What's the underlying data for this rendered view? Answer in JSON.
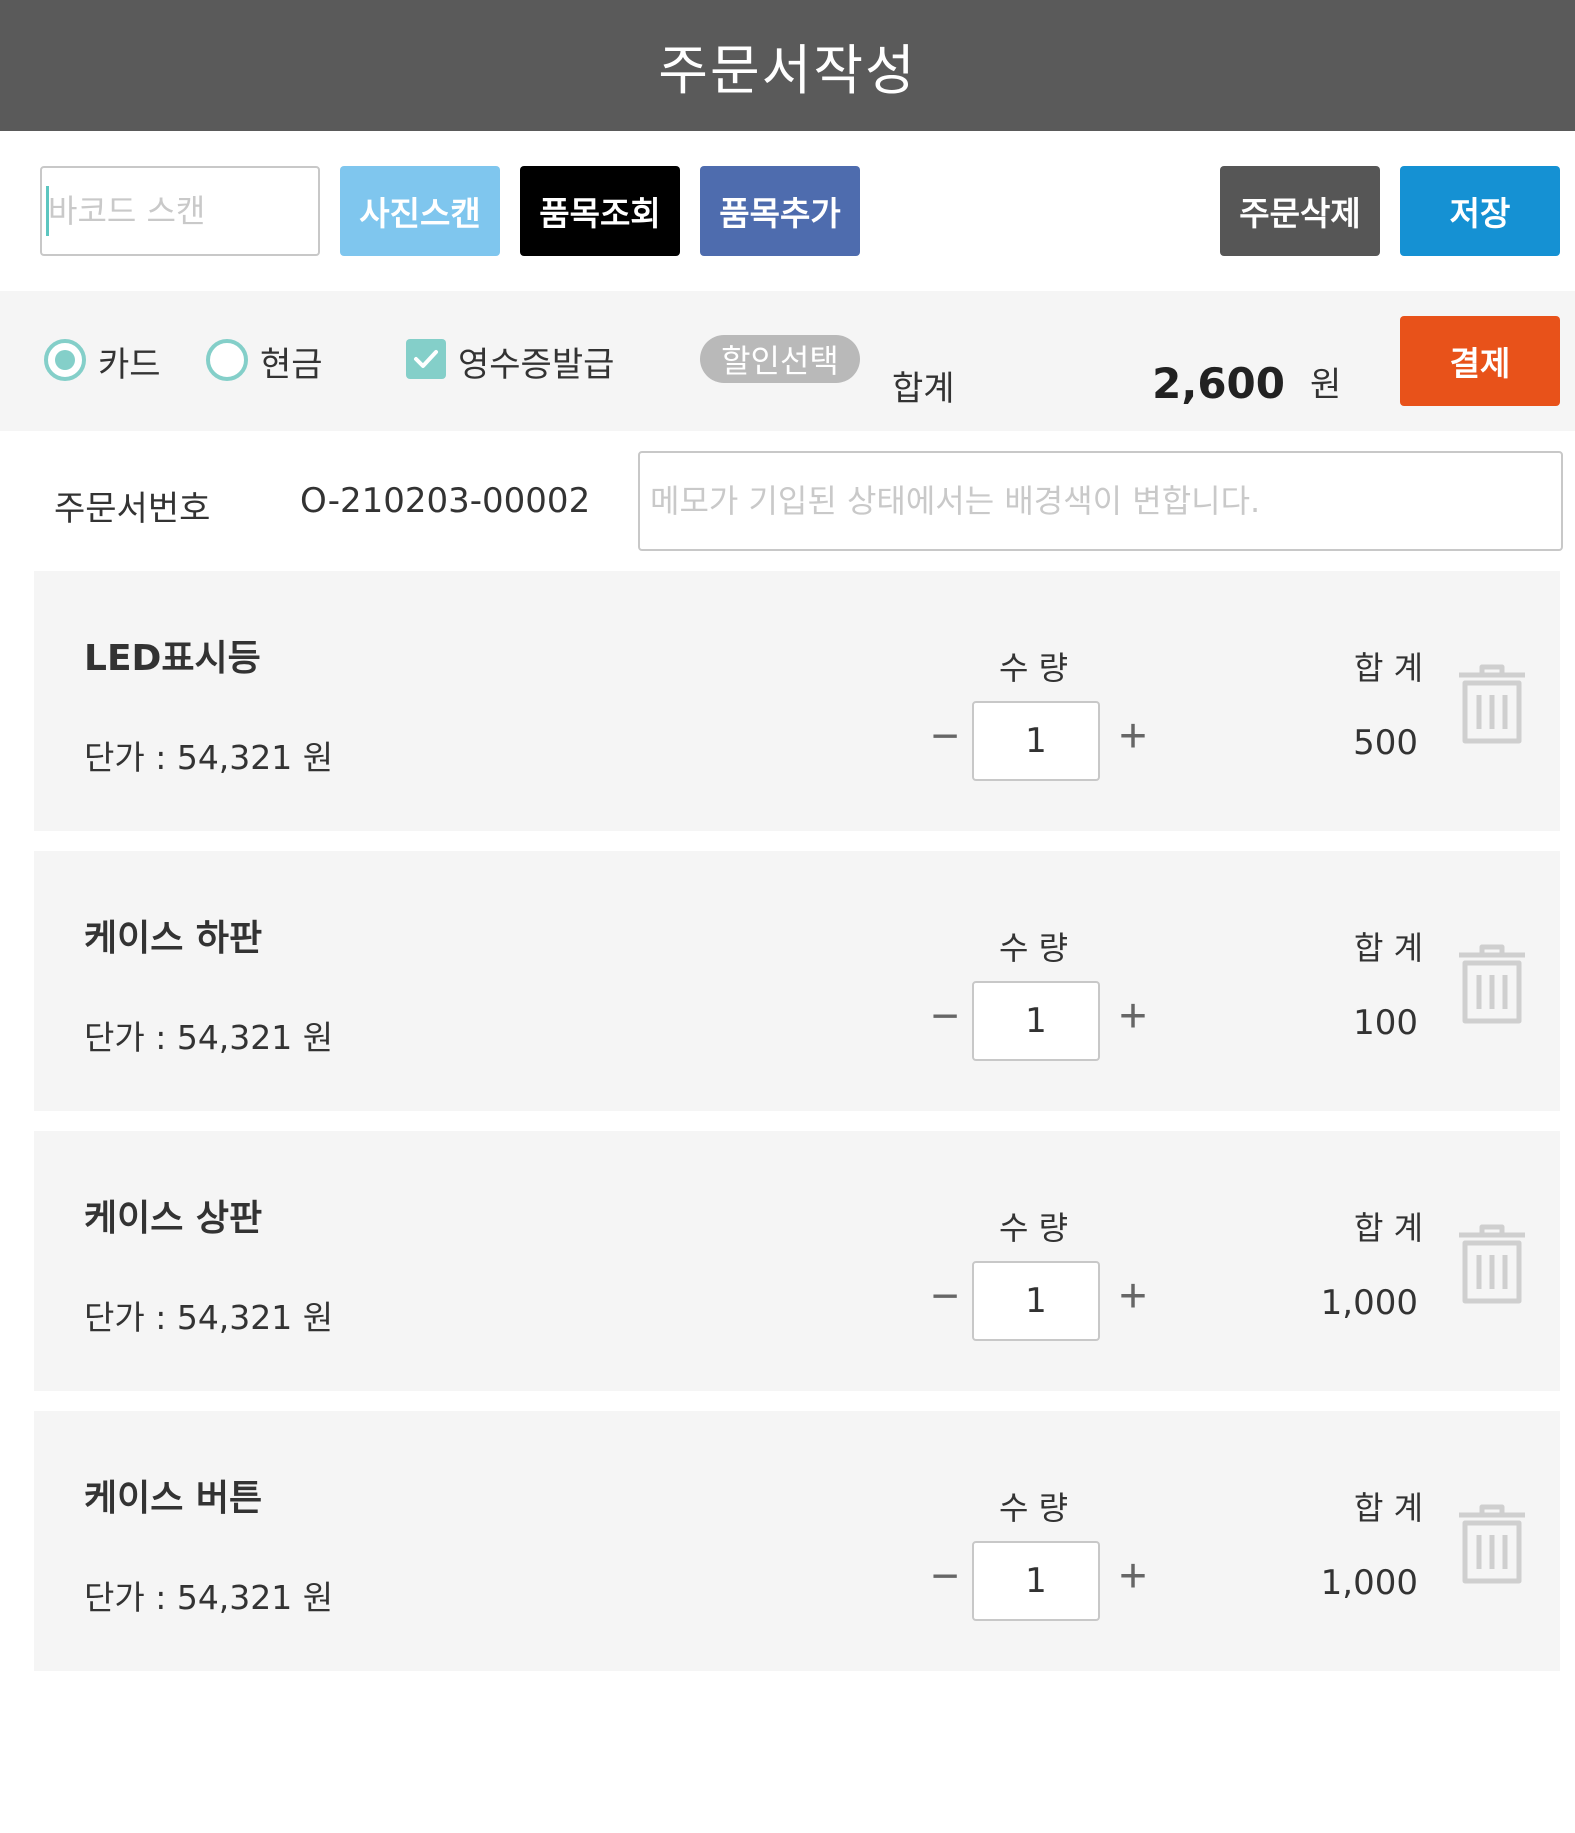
{
  "header": {
    "title": "주문서작성"
  },
  "toolbar": {
    "barcode_placeholder": "바코드 스캔",
    "photo_scan_label": "사진스캔",
    "item_lookup_label": "품목조회",
    "item_add_label": "품목추가",
    "order_delete_label": "주문삭제",
    "save_label": "저장",
    "colors": {
      "photo": "#7fc6ee",
      "lookup": "#000000",
      "add": "#4e6cae",
      "delete": "#565656",
      "save": "#1591d3"
    }
  },
  "payment": {
    "card_label": "카드",
    "cash_label": "현금",
    "selected_method": "카드",
    "receipt_label": "영수증발급",
    "receipt_checked": true,
    "discount_label": "할인선택",
    "total_label": "합계",
    "total_amount": "2,600",
    "currency_unit": "원",
    "pay_label": "결제",
    "pay_color": "#e8521a"
  },
  "order": {
    "number_label": "주문서번호",
    "number_value": "O-210203-00002",
    "memo_placeholder": "메모가 기입된 상태에서는 배경색이 변합니다."
  },
  "items": [
    {
      "name": "LED표시등",
      "unit_price": "단가 : 54,321 원",
      "qty_label": "수 량",
      "sum_label": "합 계",
      "qty": "1",
      "total": "500"
    },
    {
      "name": "케이스 하판",
      "unit_price": "단가 : 54,321 원",
      "qty_label": "수 량",
      "sum_label": "합 계",
      "qty": "1",
      "total": "100"
    },
    {
      "name": "케이스 상판",
      "unit_price": "단가 : 54,321 원",
      "qty_label": "수 량",
      "sum_label": "합 계",
      "qty": "1",
      "total": "1,000"
    },
    {
      "name": "케이스 버튼",
      "unit_price": "단가 : 54,321 원",
      "qty_label": "수 량",
      "sum_label": "합 계",
      "qty": "1",
      "total": "1,000"
    }
  ],
  "icons": {
    "minus": "minus-icon",
    "plus": "plus-icon",
    "delete": "trash-icon",
    "check": "check-icon"
  }
}
